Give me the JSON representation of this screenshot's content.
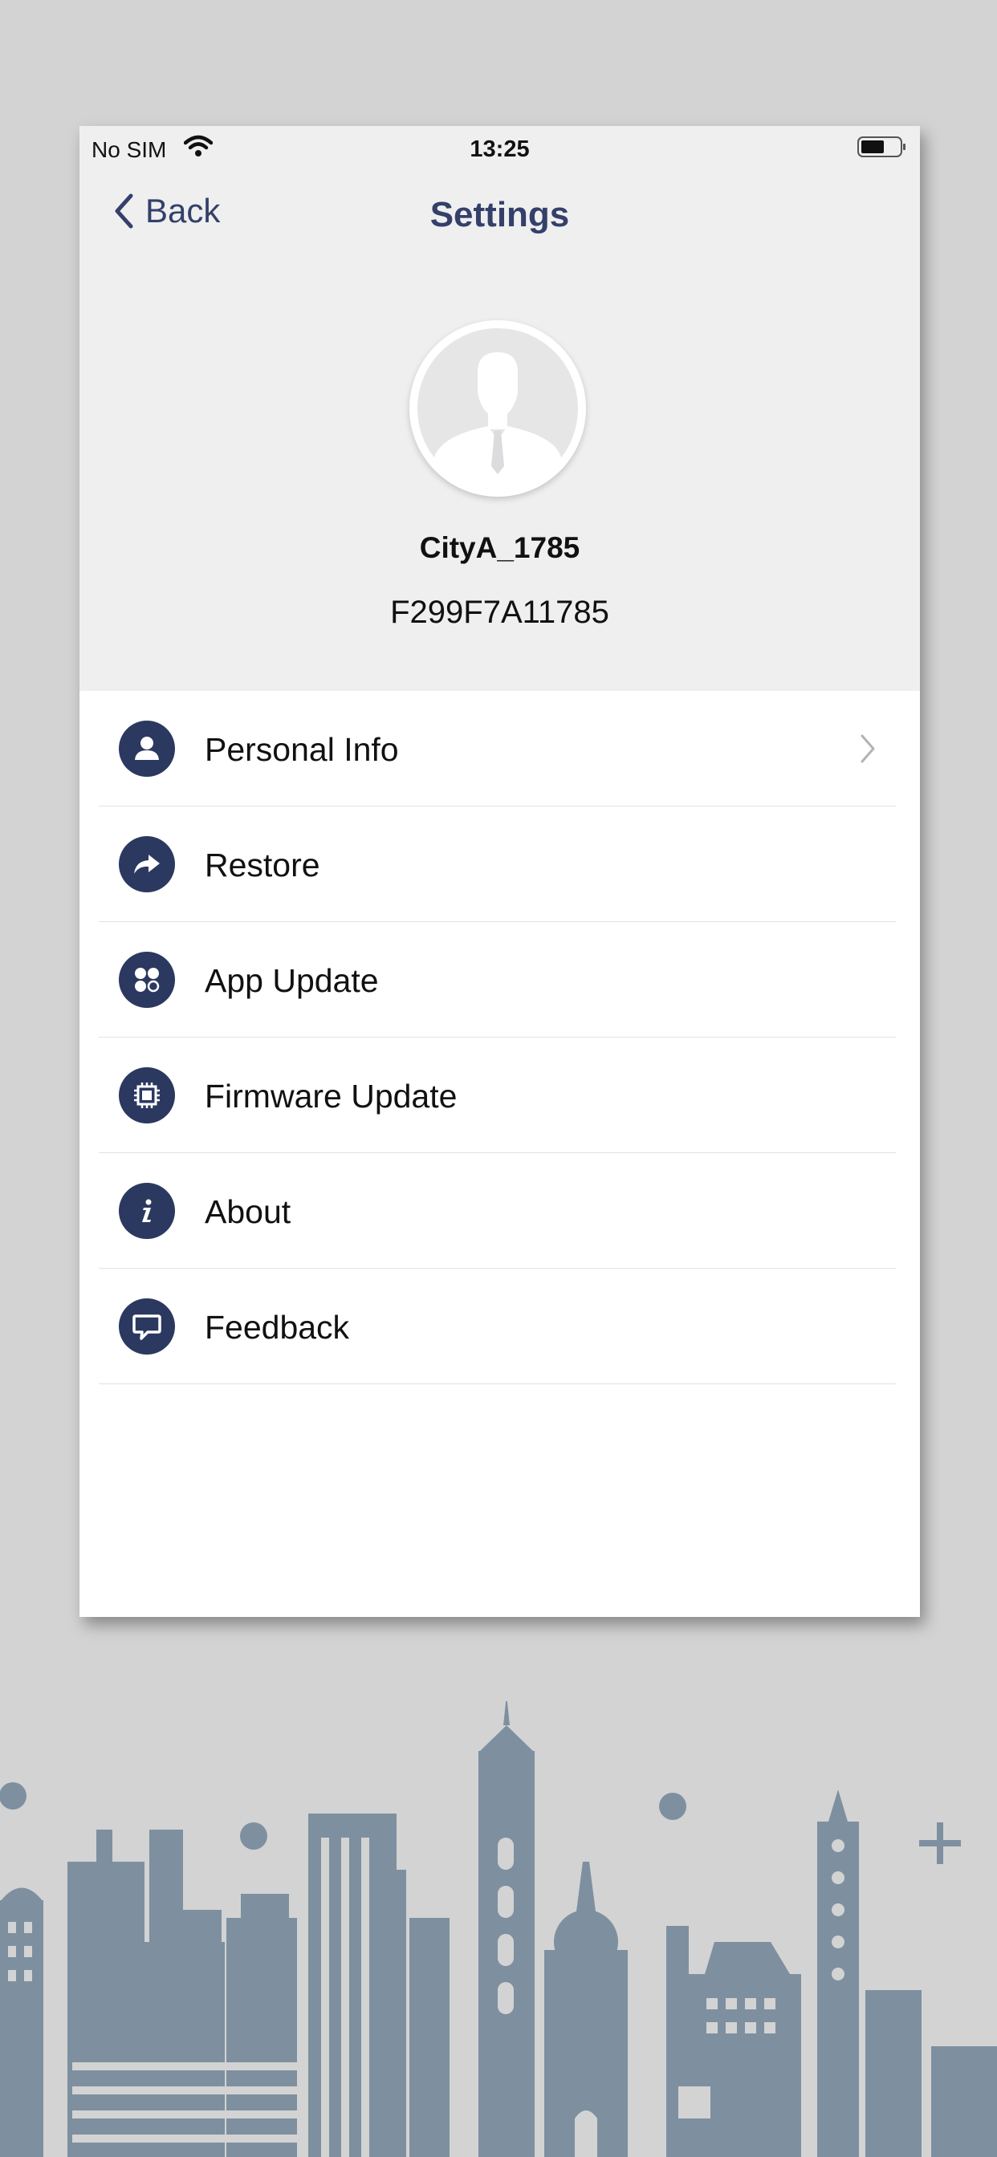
{
  "status_bar": {
    "carrier": "No SIM",
    "time": "13:25"
  },
  "nav": {
    "back_label": "Back",
    "title": "Settings"
  },
  "profile": {
    "username": "CityA_1785",
    "device_id": "F299F7A11785"
  },
  "menu": [
    {
      "label": "Personal Info",
      "icon": "person-icon",
      "has_chevron": true
    },
    {
      "label": "Restore",
      "icon": "share-arrow-icon",
      "has_chevron": false
    },
    {
      "label": "App Update",
      "icon": "apps-icon",
      "has_chevron": false
    },
    {
      "label": "Firmware Update",
      "icon": "chip-icon",
      "has_chevron": false
    },
    {
      "label": "About",
      "icon": "info-icon",
      "has_chevron": false
    },
    {
      "label": "Feedback",
      "icon": "chat-bubble-icon",
      "has_chevron": false
    }
  ],
  "colors": {
    "accent": "#34406a",
    "icon_bg": "#2b3960",
    "header_bg": "#efeff0",
    "page_bg": "#d3d3d4",
    "skyline": "#7e909f"
  }
}
